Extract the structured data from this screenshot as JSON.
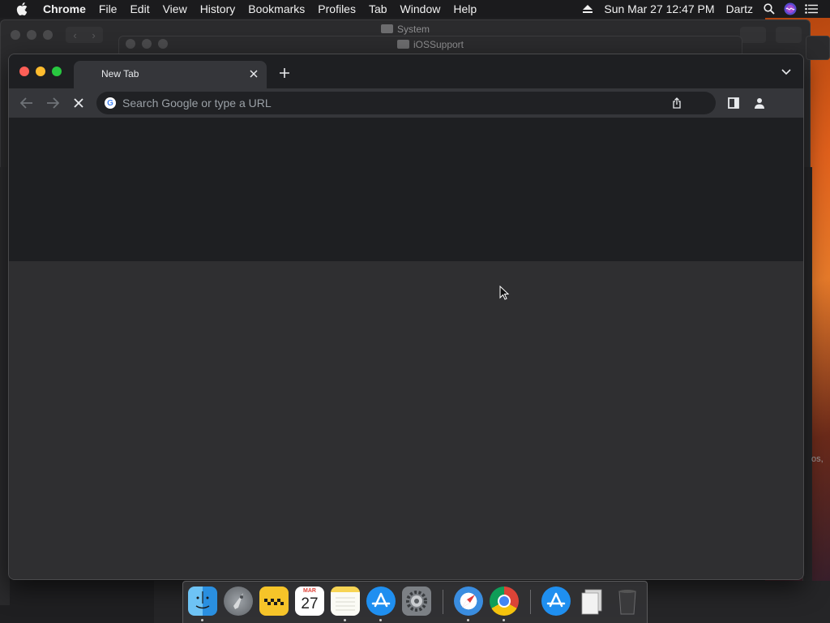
{
  "menubar": {
    "app_name": "Chrome",
    "menus": [
      "File",
      "Edit",
      "View",
      "History",
      "Bookmarks",
      "Profiles",
      "Tab",
      "Window",
      "Help"
    ],
    "datetime": "Sun Mar 27  12:47 PM",
    "user": "Dartz"
  },
  "background_windows": {
    "system_title": "System",
    "iossupport_title": "iOSSupport",
    "partial_text": "os,"
  },
  "browser": {
    "tab_title": "New Tab",
    "omnibox_placeholder": "Search Google or type a URL",
    "omnibox_value": ""
  },
  "dock": {
    "apps": [
      "finder",
      "launchpad",
      "taxi",
      "calendar",
      "notes",
      "app-store",
      "system-preferences",
      "safari",
      "chrome",
      "app-store-2",
      "documents",
      "trash"
    ],
    "calendar_month": "MAR",
    "calendar_day": "27"
  }
}
